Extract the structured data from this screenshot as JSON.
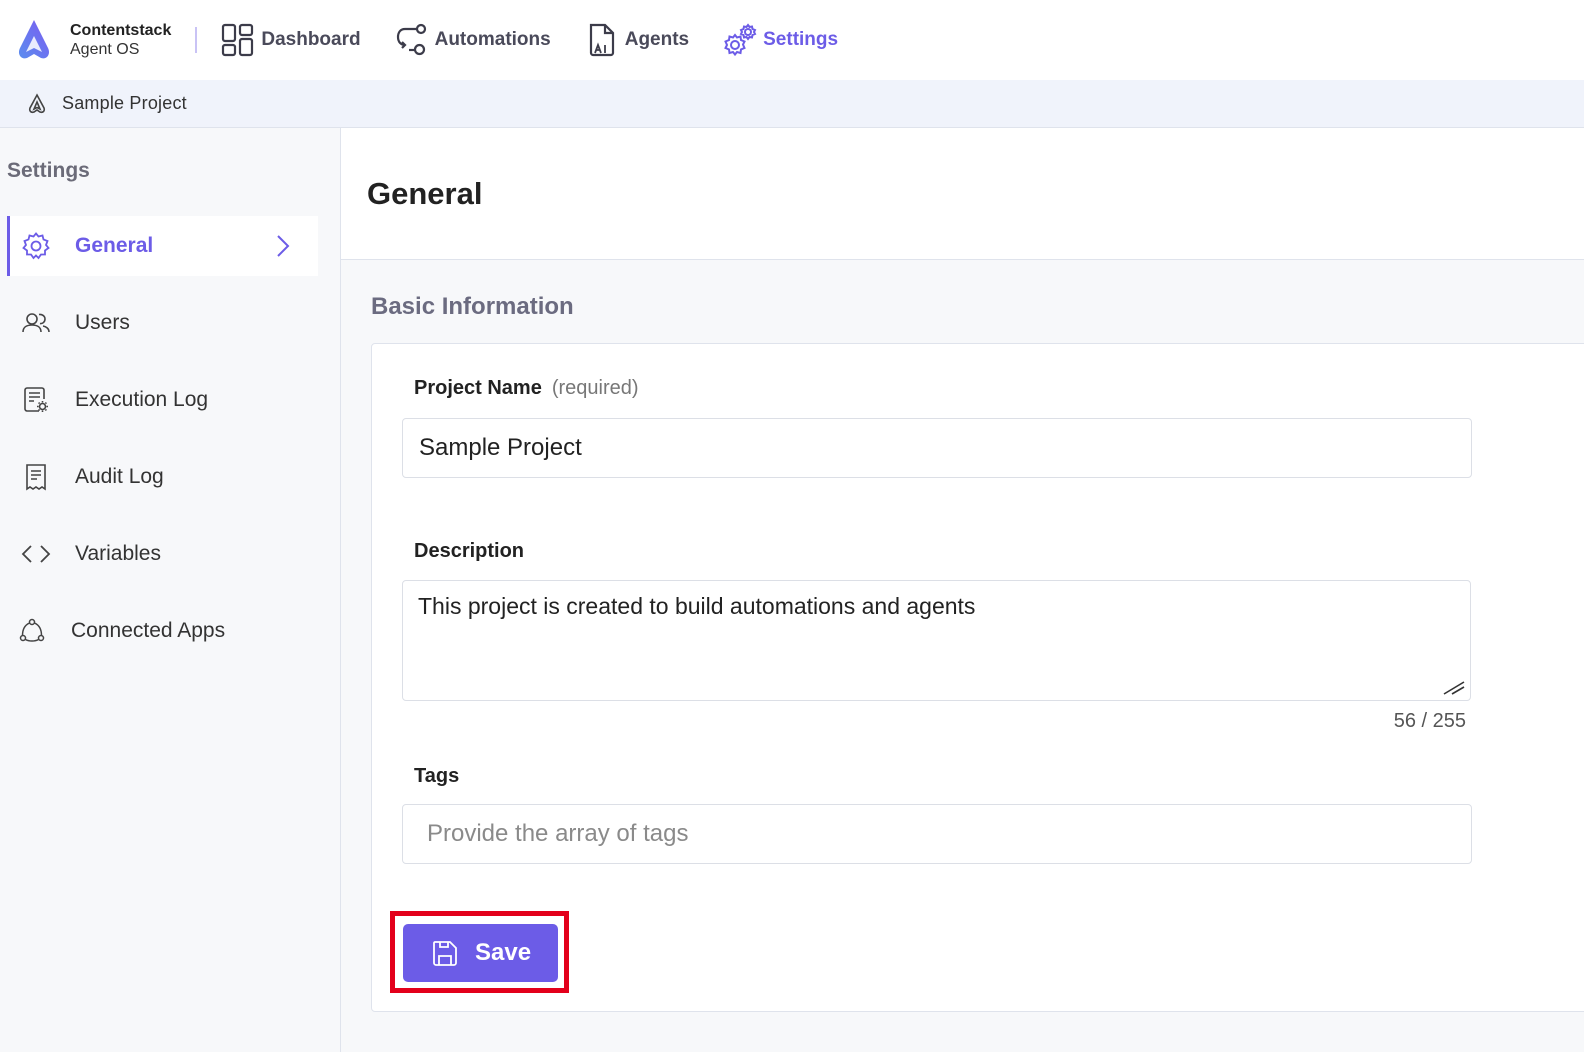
{
  "brand": {
    "name": "Contentstack",
    "subtitle": "Agent OS"
  },
  "nav": {
    "items": [
      {
        "label": "Dashboard",
        "icon": "dashboard-icon",
        "active": false
      },
      {
        "label": "Automations",
        "icon": "automations-icon",
        "active": false
      },
      {
        "label": "Agents",
        "icon": "agents-icon",
        "active": false
      },
      {
        "label": "Settings",
        "icon": "settings-gears-icon",
        "active": true
      }
    ]
  },
  "breadcrumb": {
    "project": "Sample Project"
  },
  "sidebar": {
    "title": "Settings",
    "items": [
      {
        "label": "General",
        "icon": "gear-icon",
        "active": true
      },
      {
        "label": "Users",
        "icon": "users-icon",
        "active": false
      },
      {
        "label": "Execution Log",
        "icon": "execution-log-icon",
        "active": false
      },
      {
        "label": "Audit Log",
        "icon": "audit-log-icon",
        "active": false
      },
      {
        "label": "Variables",
        "icon": "code-brackets-icon",
        "active": false
      },
      {
        "label": "Connected Apps",
        "icon": "connected-apps-icon",
        "active": false
      }
    ]
  },
  "main": {
    "title": "General",
    "section": "Basic Information",
    "form": {
      "project_name_label": "Project Name",
      "project_name_hint": "(required)",
      "project_name_value": "Sample Project",
      "description_label": "Description",
      "description_value": "This project is created to build automations and agents",
      "description_counter": "56 / 255",
      "tags_label": "Tags",
      "tags_placeholder": "Provide the array of tags",
      "save_label": "Save"
    }
  },
  "colors": {
    "accent": "#6c5ce7",
    "highlight": "#e3001b",
    "breadcrumb_bg": "#f0f3fb",
    "sidebar_bg": "#f7f8fa"
  }
}
